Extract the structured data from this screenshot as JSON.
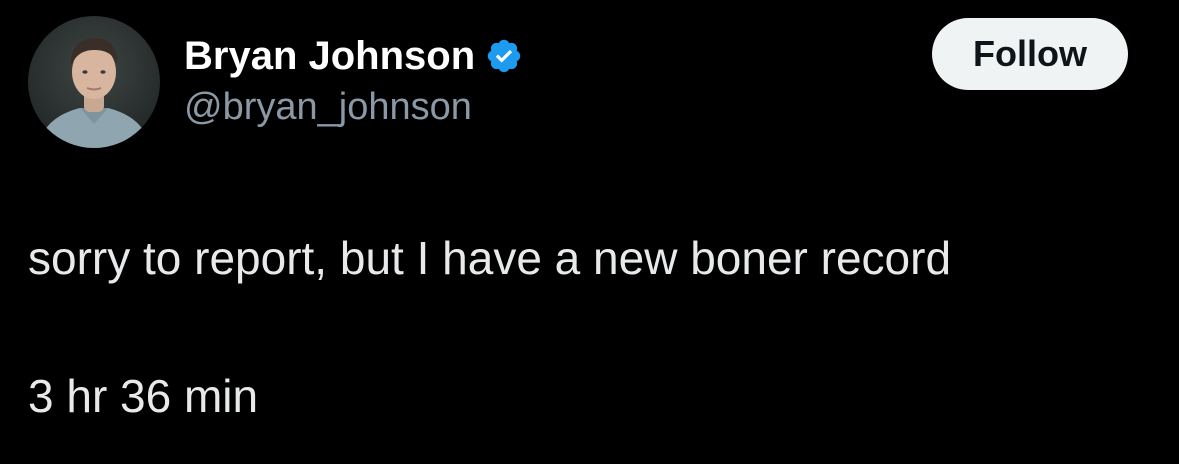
{
  "author": {
    "display_name": "Bryan Johnson",
    "handle": "@bryan_johnson",
    "verified": true,
    "verified_color": "#1d9bf0"
  },
  "follow_button": {
    "label": "Follow"
  },
  "tweet": {
    "lines": [
      "sorry to report, but I have a new boner record",
      "3 hr 36 min"
    ]
  },
  "colors": {
    "background": "#000000",
    "text": "#e7e9ea",
    "handle": "#8b98a5",
    "button_bg": "#eff3f4",
    "button_text": "#0f1419"
  }
}
